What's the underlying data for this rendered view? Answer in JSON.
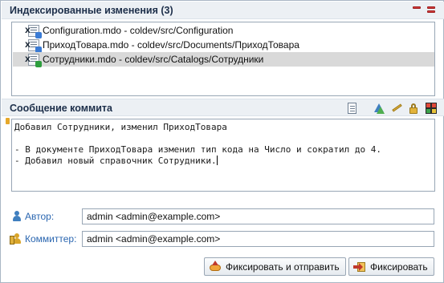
{
  "staged": {
    "title": "Индексированные изменения (3)",
    "files": [
      {
        "label": "Configuration.mdo - coldev/src/Configuration",
        "mark": "X",
        "status": "modified",
        "selected": false
      },
      {
        "label": "ПриходТовара.mdo - coldev/src/Documents/ПриходТовара",
        "mark": "X",
        "status": "modified",
        "selected": false
      },
      {
        "label": "Сотрудники.mdo - coldev/src/Catalogs/Сотрудники",
        "mark": "X",
        "status": "added",
        "selected": true
      }
    ],
    "toolbar_icons": [
      "unstage-selected-icon",
      "unstage-all-icon"
    ]
  },
  "commit_message": {
    "title": "Сообщение коммита",
    "toolbar_icons": [
      "compare-icon",
      "sign-off-icon",
      "amend-icon",
      "lock-icon",
      "change-id-icon"
    ],
    "lines": [
      "Добавил Сотрудники, изменил ПриходТовара",
      "",
      "- В документе ПриходТовара изменил тип кода на Число и сократил до 4.",
      "- Добавил новый справочник Сотрудники."
    ]
  },
  "author": {
    "label": "Автор:",
    "value": "admin <admin@example.com>"
  },
  "committer": {
    "label": "Коммиттер:",
    "value": "admin <admin@example.com>"
  },
  "buttons": {
    "commit_and_push": "Фиксировать и отправить",
    "commit": "Фиксировать"
  },
  "colors": {
    "header_bg": "#ecf0f4",
    "selected_row": "#d9d9d9",
    "label_blue": "#2a66b0",
    "border": "#98a6b5"
  }
}
